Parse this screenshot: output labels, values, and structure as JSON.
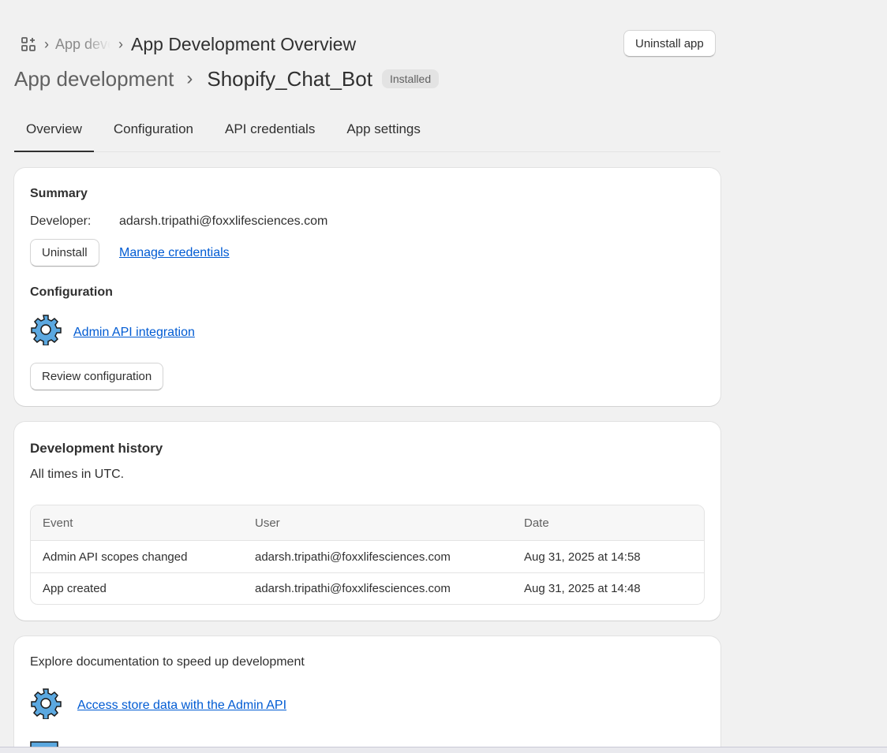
{
  "header": {
    "breadcrumb_faded": "App development",
    "page_heading": "App Development Overview",
    "uninstall_app_label": "Uninstall app"
  },
  "title": {
    "parent": "App development",
    "current": "Shopify_Chat_Bot",
    "status_badge": "Installed"
  },
  "tabs": [
    {
      "label": "Overview",
      "active": true
    },
    {
      "label": "Configuration",
      "active": false
    },
    {
      "label": "API credentials",
      "active": false
    },
    {
      "label": "App settings",
      "active": false
    }
  ],
  "summary": {
    "title": "Summary",
    "developer_label": "Developer:",
    "developer_value": "adarsh.tripathi@foxxlifesciences.com",
    "uninstall_label": "Uninstall",
    "manage_credentials_label": "Manage credentials",
    "configuration_title": "Configuration",
    "admin_api_link": "Admin API integration",
    "review_configuration_label": "Review configuration"
  },
  "history": {
    "title": "Development history",
    "subtitle": "All times in UTC.",
    "columns": [
      "Event",
      "User",
      "Date"
    ],
    "rows": [
      [
        "Admin API scopes changed",
        "adarsh.tripathi@foxxlifesciences.com",
        "Aug 31, 2025 at 14:58"
      ],
      [
        "App created",
        "adarsh.tripathi@foxxlifesciences.com",
        "Aug 31, 2025 at 14:48"
      ]
    ]
  },
  "docs": {
    "title": "Explore documentation to speed up development",
    "links": [
      "Access store data with the Admin API"
    ]
  },
  "colors": {
    "link": "#005bd3",
    "background": "#f1f1f1",
    "badge_bg": "#e3e3e3",
    "gear_fill": "#5ba8e0"
  }
}
